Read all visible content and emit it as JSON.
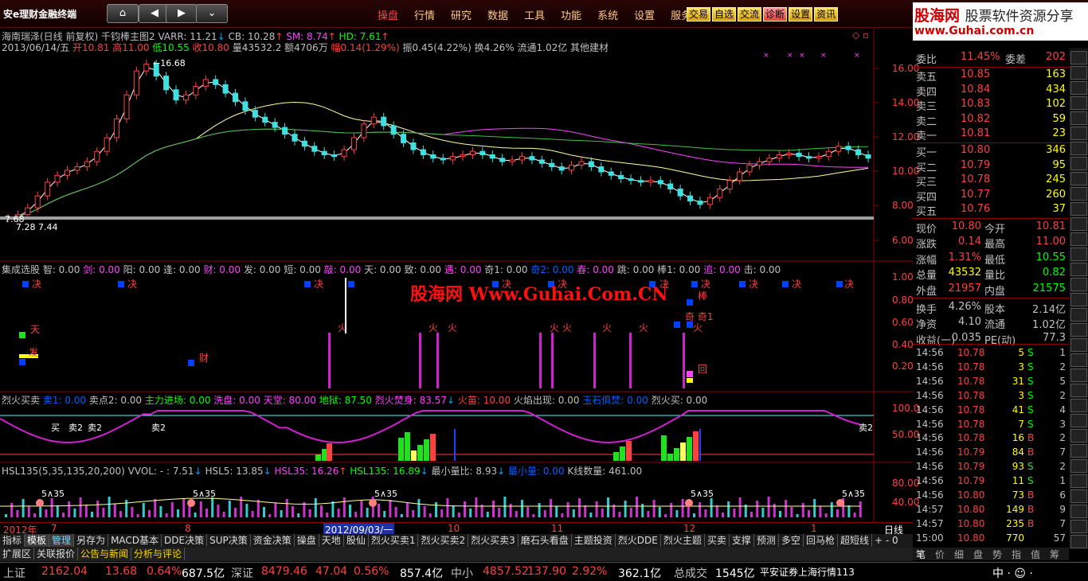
{
  "app": {
    "logo": "安e理财金融终端"
  },
  "nav": {
    "home": "⌂",
    "back": "◀",
    "fwd": "▶",
    "more": "⌄"
  },
  "menu": [
    "操盘",
    "行情",
    "研究",
    "数据",
    "工具",
    "功能",
    "系统",
    "设置",
    "服务"
  ],
  "tools": [
    "交易",
    "自选",
    "交流",
    "诊断",
    "设置",
    "资讯"
  ],
  "brand": {
    "title": "股海网",
    "subtitle": "股票软件资源分享",
    "url": "www.Guhai.com.cn"
  },
  "main_panel": {
    "line1": [
      {
        "t": "海南瑞泽(日线 前复权) 千钧棒主图2 VARR: 11.21",
        "c": "#c0c0c0"
      },
      {
        "t": "↓",
        "c": "#00a0ff"
      },
      {
        "t": " CB: 10.28",
        "c": "#c0c0c0"
      },
      {
        "t": "↑",
        "c": "#ff4040"
      },
      {
        "t": "  SM: 8.74",
        "c": "#ff40ff"
      },
      {
        "t": "↑",
        "c": "#ff4040"
      },
      {
        "t": "  HD: 7.61",
        "c": "#00ff00"
      },
      {
        "t": "↑",
        "c": "#ff4040"
      }
    ],
    "line2": [
      {
        "t": "2013/06/14/五 ",
        "c": "#c0c0c0"
      },
      {
        "t": "开10.81 ",
        "c": "#ff4040"
      },
      {
        "t": "高11.00 ",
        "c": "#ff4040"
      },
      {
        "t": "低10.55 ",
        "c": "#00ff00"
      },
      {
        "t": "收10.80 ",
        "c": "#ff4040"
      },
      {
        "t": "量43532.2 额4706万 ",
        "c": "#c0c0c0"
      },
      {
        "t": "幅0.14(1.29%) ",
        "c": "#ff4040"
      },
      {
        "t": "振0.45(4.22%) 换4.26% 流通1.02亿 其他建材",
        "c": "#c0c0c0"
      }
    ],
    "annotations": {
      "high": "16.68",
      "low1": "7.28",
      "low2": "7.44",
      "low3": "7.68"
    },
    "y_labels": [
      "16.00",
      "14.00",
      "12.00",
      "10.00",
      "8.00",
      "6.00"
    ],
    "chart_data": {
      "type": "line",
      "x_range_label": "2012年 - 2013/06/14",
      "close": [
        7.3,
        7.5,
        7.9,
        8.6,
        9.4,
        9.8,
        10.1,
        10.3,
        10.6,
        11.2,
        12.0,
        13.1,
        14.5,
        15.9,
        16.3,
        15.6,
        14.8,
        14.2,
        14.5,
        15.0,
        15.4,
        15.1,
        14.6,
        14.1,
        13.6,
        13.2,
        12.9,
        12.6,
        12.2,
        11.8,
        11.5,
        11.2,
        11.0,
        10.9,
        11.3,
        12.0,
        12.8,
        13.2,
        12.7,
        12.2,
        11.7,
        11.3,
        11.0,
        10.8,
        10.7,
        10.9,
        11.0,
        11.2,
        11.0,
        10.8,
        10.6,
        10.7,
        10.9,
        10.7,
        10.5,
        10.3,
        10.1,
        10.4,
        10.6,
        10.3,
        10.0,
        9.8,
        9.6,
        9.5,
        9.4,
        9.5,
        9.3,
        9.0,
        8.6,
        8.3,
        8.1,
        8.5,
        9.0,
        9.5,
        10.0,
        10.4,
        10.6,
        10.8,
        11.0,
        11.1,
        10.9,
        10.8,
        10.9,
        11.2,
        11.5,
        11.3,
        11.0,
        10.8
      ]
    }
  },
  "jc_panel": {
    "title": [
      {
        "t": "集成选股 ",
        "c": "#c0c0c0"
      },
      {
        "t": "智: 0.00  ",
        "c": "#c0c0c0"
      },
      {
        "t": "剑: 0.00  ",
        "c": "#ff40ff"
      },
      {
        "t": "阳: 0.00  ",
        "c": "#c0c0c0"
      },
      {
        "t": "逢: 0.00  ",
        "c": "#c0c0c0"
      },
      {
        "t": "财: 0.00  ",
        "c": "#ff40ff"
      },
      {
        "t": "发: 0.00  ",
        "c": "#c0c0c0"
      },
      {
        "t": "短: 0.00  ",
        "c": "#c0c0c0"
      },
      {
        "t": "敲: 0.00  ",
        "c": "#ff40ff"
      },
      {
        "t": "天: 0.00  ",
        "c": "#c0c0c0"
      },
      {
        "t": "致: 0.00  ",
        "c": "#c0c0c0"
      },
      {
        "t": "遇: 0.00  ",
        "c": "#ff40ff"
      },
      {
        "t": "奇1: 0.00  ",
        "c": "#c0c0c0"
      },
      {
        "t": "奇2: 0.00  ",
        "c": "#0060ff"
      },
      {
        "t": "春: 0.00  ",
        "c": "#ff40ff"
      },
      {
        "t": "跳: 0.00  ",
        "c": "#c0c0c0"
      },
      {
        "t": "棒1: 0.00  ",
        "c": "#c0c0c0"
      },
      {
        "t": "追: 0.00  ",
        "c": "#ff40ff"
      },
      {
        "t": "击: 0.00",
        "c": "#c0c0c0"
      }
    ],
    "y_labels": [
      "1.00",
      "0.80",
      "0.60",
      "0.40",
      "0.20"
    ],
    "watermark": "股海网 Www.Guhai.Com.CN",
    "labels": [
      "决",
      "天",
      "发",
      "财",
      "火",
      "棒",
      "奇1",
      "回"
    ]
  },
  "lh_panel": {
    "title": [
      {
        "t": "烈火买卖 ",
        "c": "#c0c0c0"
      },
      {
        "t": "卖1: 0.00 ",
        "c": "#0060ff"
      },
      {
        "t": "  卖点2: 0.00 ",
        "c": "#c0c0c0"
      },
      {
        "t": "  主力进场: 0.00 ",
        "c": "#00ff00"
      },
      {
        "t": "  洗盘: 0.00 ",
        "c": "#ff40ff"
      },
      {
        "t": "  天堂: 80.00 ",
        "c": "#ff40ff"
      },
      {
        "t": "  地狱: 87.50 ",
        "c": "#00ff00"
      },
      {
        "t": "  烈火焚身: 83.57",
        "c": "#ff40ff"
      },
      {
        "t": "↓",
        "c": "#00a0ff"
      },
      {
        "t": "  火苗: 10.00 ",
        "c": "#ff4040"
      },
      {
        "t": "  火焰出现: 0.00 ",
        "c": "#c0c0c0"
      },
      {
        "t": "  玉石俱焚: 0.00 ",
        "c": "#0060ff"
      },
      {
        "t": "  烈火买: 0.00",
        "c": "#c0c0c0"
      }
    ],
    "y_labels": [
      "100.0",
      "50.00"
    ],
    "marks": [
      "买",
      "卖2",
      "卖2",
      "卖2",
      "卖2"
    ]
  },
  "hsl_panel": {
    "title": [
      {
        "t": "HSL135(5,35,135,20,200) VVOL: - : 7.51",
        "c": "#c0c0c0"
      },
      {
        "t": "↓",
        "c": "#00a0ff"
      },
      {
        "t": "  HSL5: 13.85",
        "c": "#c0c0c0"
      },
      {
        "t": "↓",
        "c": "#00a0ff"
      },
      {
        "t": "  HSL35: 16.26",
        "c": "#ff40ff"
      },
      {
        "t": "↑",
        "c": "#ff4040"
      },
      {
        "t": "  HSL135: 16.89",
        "c": "#00ff00"
      },
      {
        "t": "↓",
        "c": "#00a0ff"
      },
      {
        "t": "  最小量比: 8.93",
        "c": "#c0c0c0"
      },
      {
        "t": "↓",
        "c": "#00a0ff"
      },
      {
        "t": "  最小量: 0.00",
        "c": "#0060ff"
      },
      {
        "t": "   K线数量: 461.00",
        "c": "#c0c0c0"
      }
    ],
    "y_labels": [
      "80.00",
      "40.00"
    ],
    "marks": [
      "5∧35",
      "5∧35",
      "5∧35",
      "5∧35",
      "5∧35"
    ]
  },
  "datebar": {
    "labels": [
      "2012年",
      "7",
      "8",
      "10",
      "11",
      "12",
      "1"
    ],
    "cursor": "2012/09/03/一",
    "right": "日线"
  },
  "orderbook": {
    "head": {
      "wb_label": "委比",
      "wb": "11.45%",
      "wc_label": "委差",
      "wc": "202"
    },
    "sells": [
      {
        "n": "卖五",
        "p": "10.85",
        "v": "163"
      },
      {
        "n": "卖四",
        "p": "10.84",
        "v": "434"
      },
      {
        "n": "卖三",
        "p": "10.83",
        "v": "102"
      },
      {
        "n": "卖二",
        "p": "10.82",
        "v": "59"
      },
      {
        "n": "卖一",
        "p": "10.81",
        "v": "23"
      }
    ],
    "buys": [
      {
        "n": "买一",
        "p": "10.80",
        "v": "346"
      },
      {
        "n": "买二",
        "p": "10.79",
        "v": "95"
      },
      {
        "n": "买三",
        "p": "10.78",
        "v": "245"
      },
      {
        "n": "买四",
        "p": "10.77",
        "v": "260"
      },
      {
        "n": "买五",
        "p": "10.76",
        "v": "37"
      }
    ]
  },
  "quote": [
    {
      "a": "现价",
      "av": "10.80",
      "ac": "#ff4040",
      "b": "今开",
      "bv": "10.81",
      "bc": "#ff4040"
    },
    {
      "a": "涨跌",
      "av": "0.14",
      "ac": "#ff4040",
      "b": "最高",
      "bv": "11.00",
      "bc": "#ff4040"
    },
    {
      "a": "涨幅",
      "av": "1.31%",
      "ac": "#ff4040",
      "b": "最低",
      "bv": "10.55",
      "bc": "#00ff00"
    },
    {
      "a": "总量",
      "av": "43532",
      "ac": "#ffff00",
      "b": "量比",
      "bv": "0.82",
      "bc": "#00ff00"
    },
    {
      "a": "外盘",
      "av": "21957",
      "ac": "#ff4040",
      "b": "内盘",
      "bv": "21575",
      "bc": "#00ff00"
    },
    {
      "a": "换手",
      "av": "4.26%",
      "ac": "#c0c0c0",
      "b": "股本",
      "bv": "2.14亿",
      "bc": "#c0c0c0"
    },
    {
      "a": "净资",
      "av": "4.10",
      "ac": "#c0c0c0",
      "b": "流通",
      "bv": "1.02亿",
      "bc": "#c0c0c0"
    },
    {
      "a": "收益(一)",
      "av": "0.035",
      "ac": "#c0c0c0",
      "b": "PE(动)",
      "bv": "77.3",
      "bc": "#c0c0c0"
    }
  ],
  "ticks": [
    {
      "t": "14:56",
      "p": "10.78",
      "v": "5",
      "s": "S",
      "n": "1"
    },
    {
      "t": "14:56",
      "p": "10.78",
      "v": "3",
      "s": "S",
      "n": "2"
    },
    {
      "t": "14:56",
      "p": "10.78",
      "v": "31",
      "s": "S",
      "n": "5"
    },
    {
      "t": "14:56",
      "p": "10.78",
      "v": "3",
      "s": "S",
      "n": "2"
    },
    {
      "t": "14:56",
      "p": "10.78",
      "v": "41",
      "s": "S",
      "n": "4"
    },
    {
      "t": "14:56",
      "p": "10.78",
      "v": "7",
      "s": "S",
      "n": "3"
    },
    {
      "t": "14:56",
      "p": "10.78",
      "v": "16",
      "s": "B",
      "n": "2"
    },
    {
      "t": "14:56",
      "p": "10.79",
      "v": "84",
      "s": "B",
      "n": "7"
    },
    {
      "t": "14:56",
      "p": "10.79",
      "v": "93",
      "s": "S",
      "n": "2"
    },
    {
      "t": "14:56",
      "p": "10.79",
      "v": "11",
      "s": "S",
      "n": "1"
    },
    {
      "t": "14:56",
      "p": "10.80",
      "v": "73",
      "s": "B",
      "n": "6"
    },
    {
      "t": "14:57",
      "p": "10.80",
      "v": "149",
      "s": "B",
      "n": "9"
    },
    {
      "t": "14:57",
      "p": "10.80",
      "v": "235",
      "s": "B",
      "n": "7"
    },
    {
      "t": "15:00",
      "p": "10.80",
      "v": "770",
      "s": "",
      "n": "57"
    }
  ],
  "rp_tabs": [
    "笔",
    "价",
    "细",
    "盘",
    "势",
    "指",
    "值",
    "筹"
  ],
  "tabs1": [
    "指标",
    "模板",
    "管理",
    "另存为",
    "MACD基本",
    "DDE决策",
    "SUP决策",
    "资金决策",
    "操盘",
    "天地",
    "股仙",
    "烈火买卖1",
    "烈火买卖2",
    "烈火买卖3",
    "磨石头看盘",
    "主题投资",
    "烈火DDE",
    "烈火主题",
    "买卖",
    "支撑",
    "预测",
    "多空",
    "回马枪",
    "超短线"
  ],
  "tabs2": [
    "扩展区",
    "关联报价",
    "公告与新闻",
    "分析与评论"
  ],
  "status": {
    "sh_label": "上证",
    "sh": "2162.04",
    "sh_chg": "13.68",
    "sh_pct": "0.64%",
    "sh_amt": "687.5亿",
    "sz_label": "深证",
    "sz": "8479.46",
    "sz_chg": "47.04",
    "sz_pct": "0.56%",
    "sz_amt": "857.4亿",
    "zx_label": "中小",
    "zx": "4857.52",
    "zx_chg": "137.90",
    "zx_pct": "2.92%",
    "zx_amt": "362.1亿",
    "total_label": "总成交",
    "total": "1545亿",
    "broker": "平安证券上海行情113",
    "ime": "中 ·  ☺ ·"
  }
}
